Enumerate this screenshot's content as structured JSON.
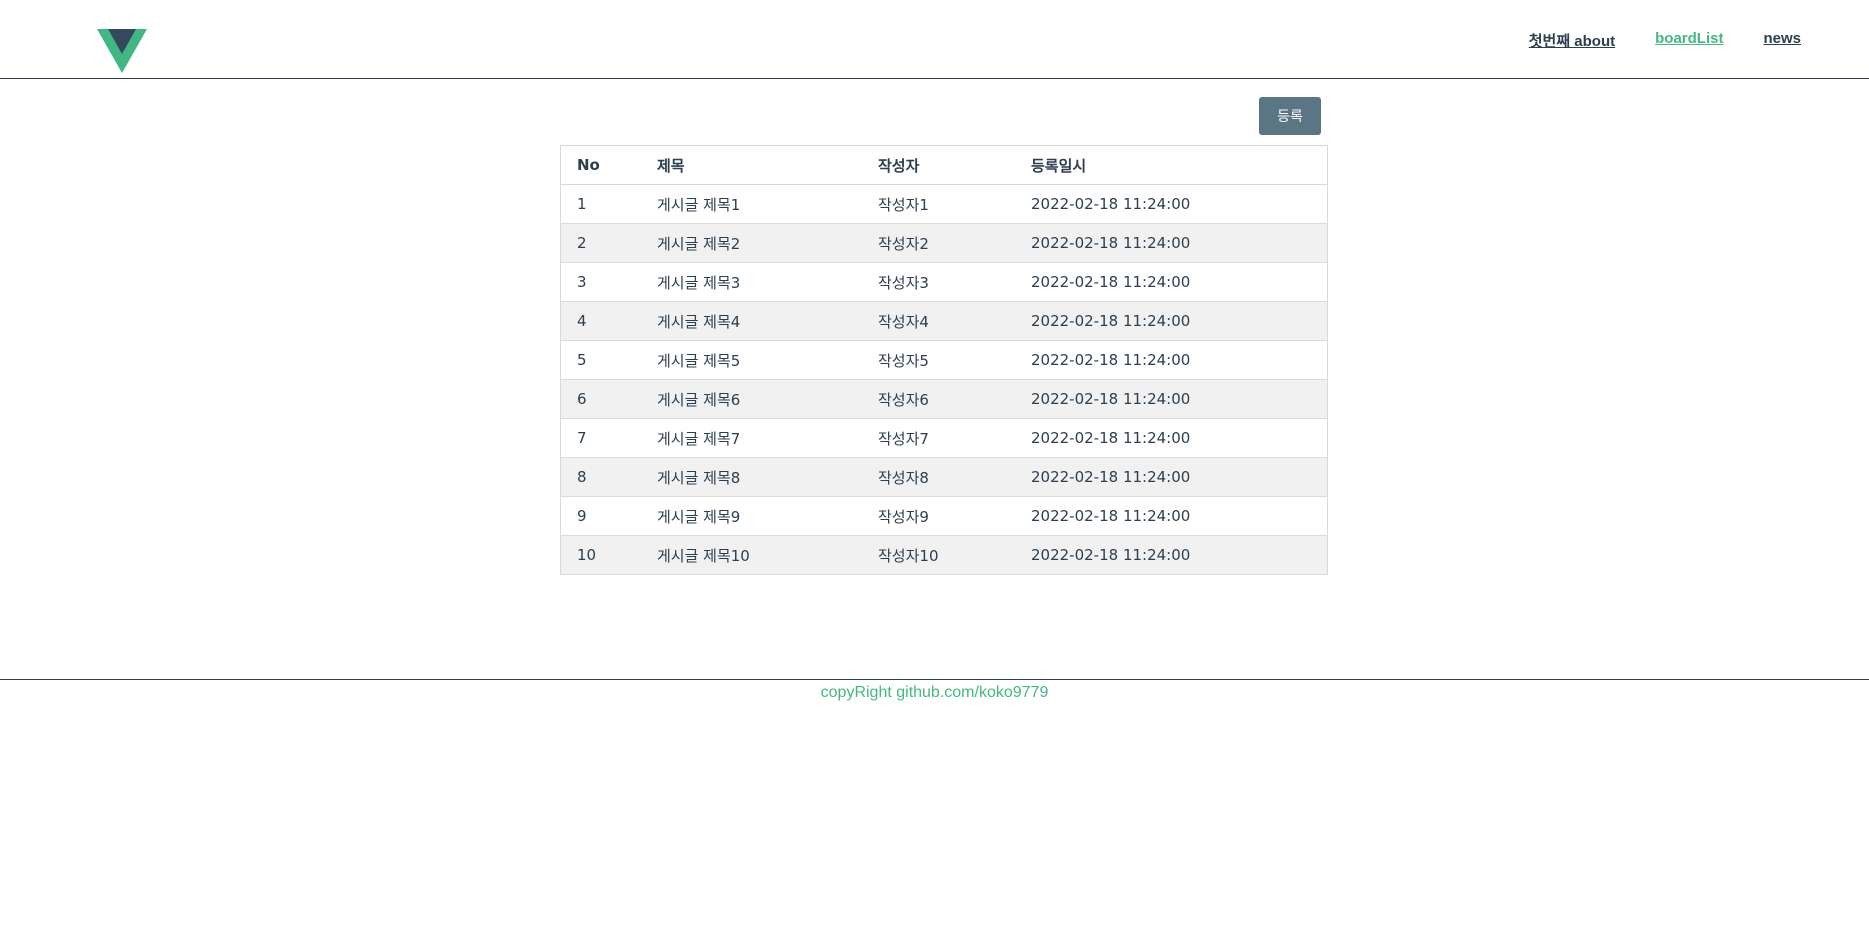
{
  "header": {
    "logo": "vue-logo",
    "nav": [
      {
        "label": "첫번째 about",
        "active": false
      },
      {
        "label": "boardList",
        "active": true
      },
      {
        "label": "news",
        "active": false
      }
    ]
  },
  "toolbar": {
    "register_label": "등록"
  },
  "table": {
    "columns": [
      "No",
      "제목",
      "작성자",
      "등록일시"
    ],
    "rows": [
      [
        "1",
        "게시글 제목1",
        "작성자1",
        "2022-02-18 11:24:00"
      ],
      [
        "2",
        "게시글 제목2",
        "작성자2",
        "2022-02-18 11:24:00"
      ],
      [
        "3",
        "게시글 제목3",
        "작성자3",
        "2022-02-18 11:24:00"
      ],
      [
        "4",
        "게시글 제목4",
        "작성자4",
        "2022-02-18 11:24:00"
      ],
      [
        "5",
        "게시글 제목5",
        "작성자5",
        "2022-02-18 11:24:00"
      ],
      [
        "6",
        "게시글 제목6",
        "작성자6",
        "2022-02-18 11:24:00"
      ],
      [
        "7",
        "게시글 제목7",
        "작성자7",
        "2022-02-18 11:24:00"
      ],
      [
        "8",
        "게시글 제목8",
        "작성자8",
        "2022-02-18 11:24:00"
      ],
      [
        "9",
        "게시글 제목9",
        "작성자9",
        "2022-02-18 11:24:00"
      ],
      [
        "10",
        "게시글 제목10",
        "작성자10",
        "2022-02-18 11:24:00"
      ]
    ]
  },
  "footer": {
    "text": "copyRight github.com/koko9779"
  },
  "colors": {
    "accent": "#42b983",
    "text": "#2c3e50",
    "button": "#5a7684"
  }
}
